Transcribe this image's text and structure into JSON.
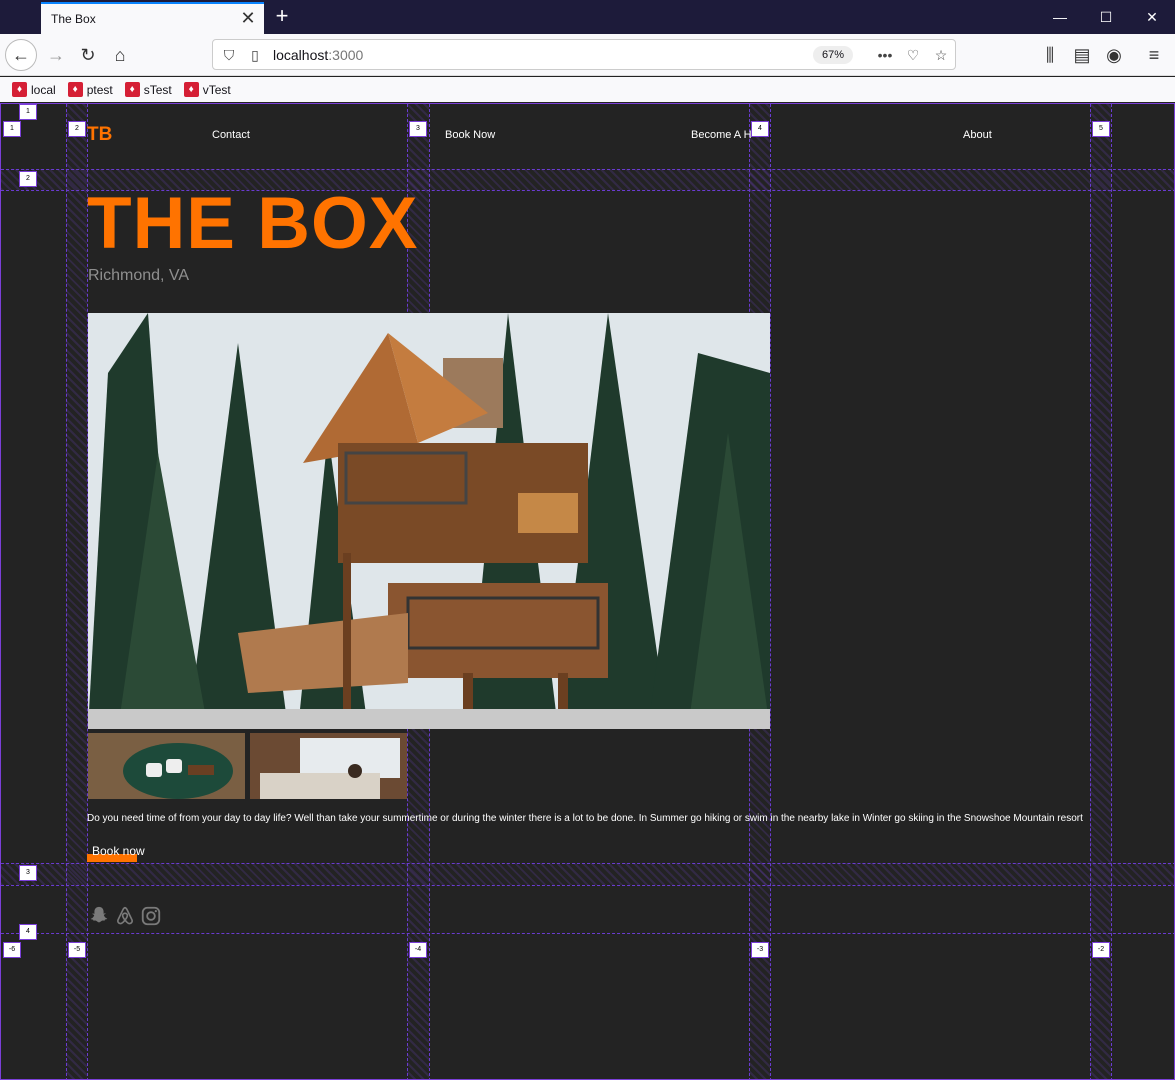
{
  "browser": {
    "tab_title": "The Box",
    "url_host": "localhost",
    "url_port": ":3000",
    "zoom": "67%",
    "bookmarks": [
      "local",
      "ptest",
      "sTest",
      "vTest"
    ]
  },
  "site": {
    "logo": "TB",
    "nav": [
      "Contact",
      "Book Now",
      "Become A H",
      "About"
    ],
    "title": "THE BOX",
    "location": "Richmond, VA",
    "description": "Do you need time of from your day to day life? Well than take your summertime or during the winter there is a lot to be done. In Summer go hiking or swim in the nearby lake in Winter go skiing in the Snowshoe Mountain resort",
    "book_label": "Book now",
    "social_icons": [
      "snapchat-icon",
      "airbnb-icon",
      "instagram-icon"
    ]
  },
  "grid_overlay": {
    "column_labels_top": [
      "1",
      "2",
      "3",
      "4",
      "5"
    ],
    "column_labels_bottom": [
      "-6",
      "-5",
      "-4",
      "-3",
      "-2"
    ],
    "row_labels": [
      "1",
      "2",
      "3",
      "4"
    ]
  },
  "colors": {
    "accent": "#ff7300",
    "background": "#232323",
    "grid": "#7b3fd8"
  }
}
